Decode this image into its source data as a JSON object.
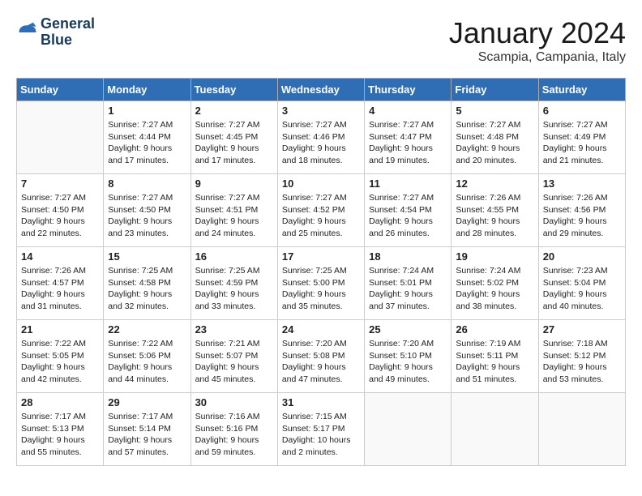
{
  "header": {
    "logo_line1": "General",
    "logo_line2": "Blue",
    "month": "January 2024",
    "location": "Scampia, Campania, Italy"
  },
  "days_of_week": [
    "Sunday",
    "Monday",
    "Tuesday",
    "Wednesday",
    "Thursday",
    "Friday",
    "Saturday"
  ],
  "weeks": [
    [
      {
        "num": "",
        "info": ""
      },
      {
        "num": "1",
        "info": "Sunrise: 7:27 AM\nSunset: 4:44 PM\nDaylight: 9 hours\nand 17 minutes."
      },
      {
        "num": "2",
        "info": "Sunrise: 7:27 AM\nSunset: 4:45 PM\nDaylight: 9 hours\nand 17 minutes."
      },
      {
        "num": "3",
        "info": "Sunrise: 7:27 AM\nSunset: 4:46 PM\nDaylight: 9 hours\nand 18 minutes."
      },
      {
        "num": "4",
        "info": "Sunrise: 7:27 AM\nSunset: 4:47 PM\nDaylight: 9 hours\nand 19 minutes."
      },
      {
        "num": "5",
        "info": "Sunrise: 7:27 AM\nSunset: 4:48 PM\nDaylight: 9 hours\nand 20 minutes."
      },
      {
        "num": "6",
        "info": "Sunrise: 7:27 AM\nSunset: 4:49 PM\nDaylight: 9 hours\nand 21 minutes."
      }
    ],
    [
      {
        "num": "7",
        "info": "Sunrise: 7:27 AM\nSunset: 4:50 PM\nDaylight: 9 hours\nand 22 minutes."
      },
      {
        "num": "8",
        "info": "Sunrise: 7:27 AM\nSunset: 4:50 PM\nDaylight: 9 hours\nand 23 minutes."
      },
      {
        "num": "9",
        "info": "Sunrise: 7:27 AM\nSunset: 4:51 PM\nDaylight: 9 hours\nand 24 minutes."
      },
      {
        "num": "10",
        "info": "Sunrise: 7:27 AM\nSunset: 4:52 PM\nDaylight: 9 hours\nand 25 minutes."
      },
      {
        "num": "11",
        "info": "Sunrise: 7:27 AM\nSunset: 4:54 PM\nDaylight: 9 hours\nand 26 minutes."
      },
      {
        "num": "12",
        "info": "Sunrise: 7:26 AM\nSunset: 4:55 PM\nDaylight: 9 hours\nand 28 minutes."
      },
      {
        "num": "13",
        "info": "Sunrise: 7:26 AM\nSunset: 4:56 PM\nDaylight: 9 hours\nand 29 minutes."
      }
    ],
    [
      {
        "num": "14",
        "info": "Sunrise: 7:26 AM\nSunset: 4:57 PM\nDaylight: 9 hours\nand 31 minutes."
      },
      {
        "num": "15",
        "info": "Sunrise: 7:25 AM\nSunset: 4:58 PM\nDaylight: 9 hours\nand 32 minutes."
      },
      {
        "num": "16",
        "info": "Sunrise: 7:25 AM\nSunset: 4:59 PM\nDaylight: 9 hours\nand 33 minutes."
      },
      {
        "num": "17",
        "info": "Sunrise: 7:25 AM\nSunset: 5:00 PM\nDaylight: 9 hours\nand 35 minutes."
      },
      {
        "num": "18",
        "info": "Sunrise: 7:24 AM\nSunset: 5:01 PM\nDaylight: 9 hours\nand 37 minutes."
      },
      {
        "num": "19",
        "info": "Sunrise: 7:24 AM\nSunset: 5:02 PM\nDaylight: 9 hours\nand 38 minutes."
      },
      {
        "num": "20",
        "info": "Sunrise: 7:23 AM\nSunset: 5:04 PM\nDaylight: 9 hours\nand 40 minutes."
      }
    ],
    [
      {
        "num": "21",
        "info": "Sunrise: 7:22 AM\nSunset: 5:05 PM\nDaylight: 9 hours\nand 42 minutes."
      },
      {
        "num": "22",
        "info": "Sunrise: 7:22 AM\nSunset: 5:06 PM\nDaylight: 9 hours\nand 44 minutes."
      },
      {
        "num": "23",
        "info": "Sunrise: 7:21 AM\nSunset: 5:07 PM\nDaylight: 9 hours\nand 45 minutes."
      },
      {
        "num": "24",
        "info": "Sunrise: 7:20 AM\nSunset: 5:08 PM\nDaylight: 9 hours\nand 47 minutes."
      },
      {
        "num": "25",
        "info": "Sunrise: 7:20 AM\nSunset: 5:10 PM\nDaylight: 9 hours\nand 49 minutes."
      },
      {
        "num": "26",
        "info": "Sunrise: 7:19 AM\nSunset: 5:11 PM\nDaylight: 9 hours\nand 51 minutes."
      },
      {
        "num": "27",
        "info": "Sunrise: 7:18 AM\nSunset: 5:12 PM\nDaylight: 9 hours\nand 53 minutes."
      }
    ],
    [
      {
        "num": "28",
        "info": "Sunrise: 7:17 AM\nSunset: 5:13 PM\nDaylight: 9 hours\nand 55 minutes."
      },
      {
        "num": "29",
        "info": "Sunrise: 7:17 AM\nSunset: 5:14 PM\nDaylight: 9 hours\nand 57 minutes."
      },
      {
        "num": "30",
        "info": "Sunrise: 7:16 AM\nSunset: 5:16 PM\nDaylight: 9 hours\nand 59 minutes."
      },
      {
        "num": "31",
        "info": "Sunrise: 7:15 AM\nSunset: 5:17 PM\nDaylight: 10 hours\nand 2 minutes."
      },
      {
        "num": "",
        "info": ""
      },
      {
        "num": "",
        "info": ""
      },
      {
        "num": "",
        "info": ""
      }
    ]
  ]
}
